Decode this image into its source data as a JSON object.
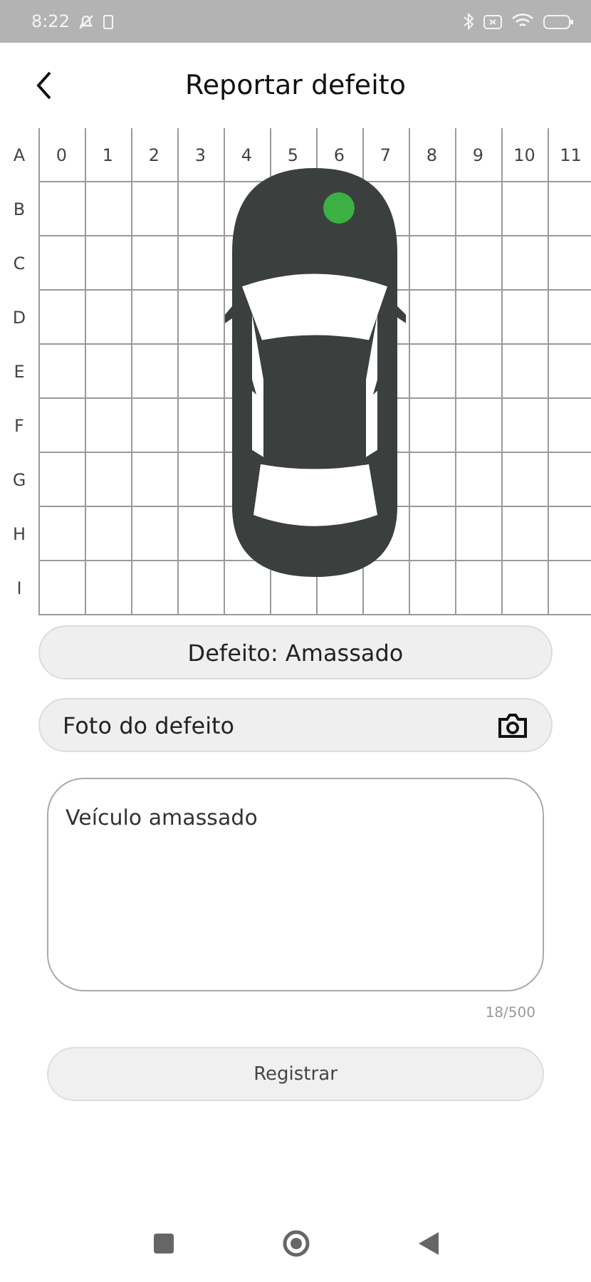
{
  "status_bar": {
    "time": "8:22"
  },
  "header": {
    "title": "Reportar defeito"
  },
  "grid": {
    "header_row": "A",
    "columns": [
      "0",
      "1",
      "2",
      "3",
      "4",
      "5",
      "6",
      "7",
      "8",
      "9",
      "10",
      "11"
    ],
    "rows": [
      {
        "label": "B",
        "marked": [
          false,
          false,
          false,
          false,
          false,
          false,
          true,
          false,
          false,
          false,
          false,
          false
        ]
      },
      {
        "label": "C",
        "marked": [
          false,
          false,
          false,
          false,
          false,
          false,
          false,
          false,
          false,
          false,
          false,
          false
        ]
      },
      {
        "label": "D",
        "marked": [
          false,
          false,
          false,
          false,
          false,
          false,
          false,
          false,
          false,
          false,
          false,
          false
        ]
      },
      {
        "label": "E",
        "marked": [
          false,
          false,
          false,
          false,
          false,
          false,
          false,
          false,
          false,
          false,
          false,
          false
        ]
      },
      {
        "label": "F",
        "marked": [
          false,
          false,
          false,
          false,
          false,
          false,
          false,
          false,
          false,
          false,
          false,
          false
        ]
      },
      {
        "label": "G",
        "marked": [
          false,
          false,
          false,
          false,
          false,
          false,
          false,
          false,
          false,
          false,
          false,
          false
        ]
      },
      {
        "label": "H",
        "marked": [
          false,
          false,
          false,
          false,
          false,
          false,
          false,
          false,
          false,
          false,
          false,
          false
        ]
      },
      {
        "label": "I",
        "marked": [
          false,
          false,
          false,
          false,
          false,
          false,
          false,
          false,
          false,
          false,
          false,
          false
        ]
      }
    ],
    "marker": {
      "color": "#3cb043"
    }
  },
  "defect_button": "Defeito: Amassado",
  "photo_field": {
    "label": "Foto do defeito"
  },
  "description": {
    "value": "Veículo amassado",
    "counter": "18/500"
  },
  "submit_button": "Registrar"
}
